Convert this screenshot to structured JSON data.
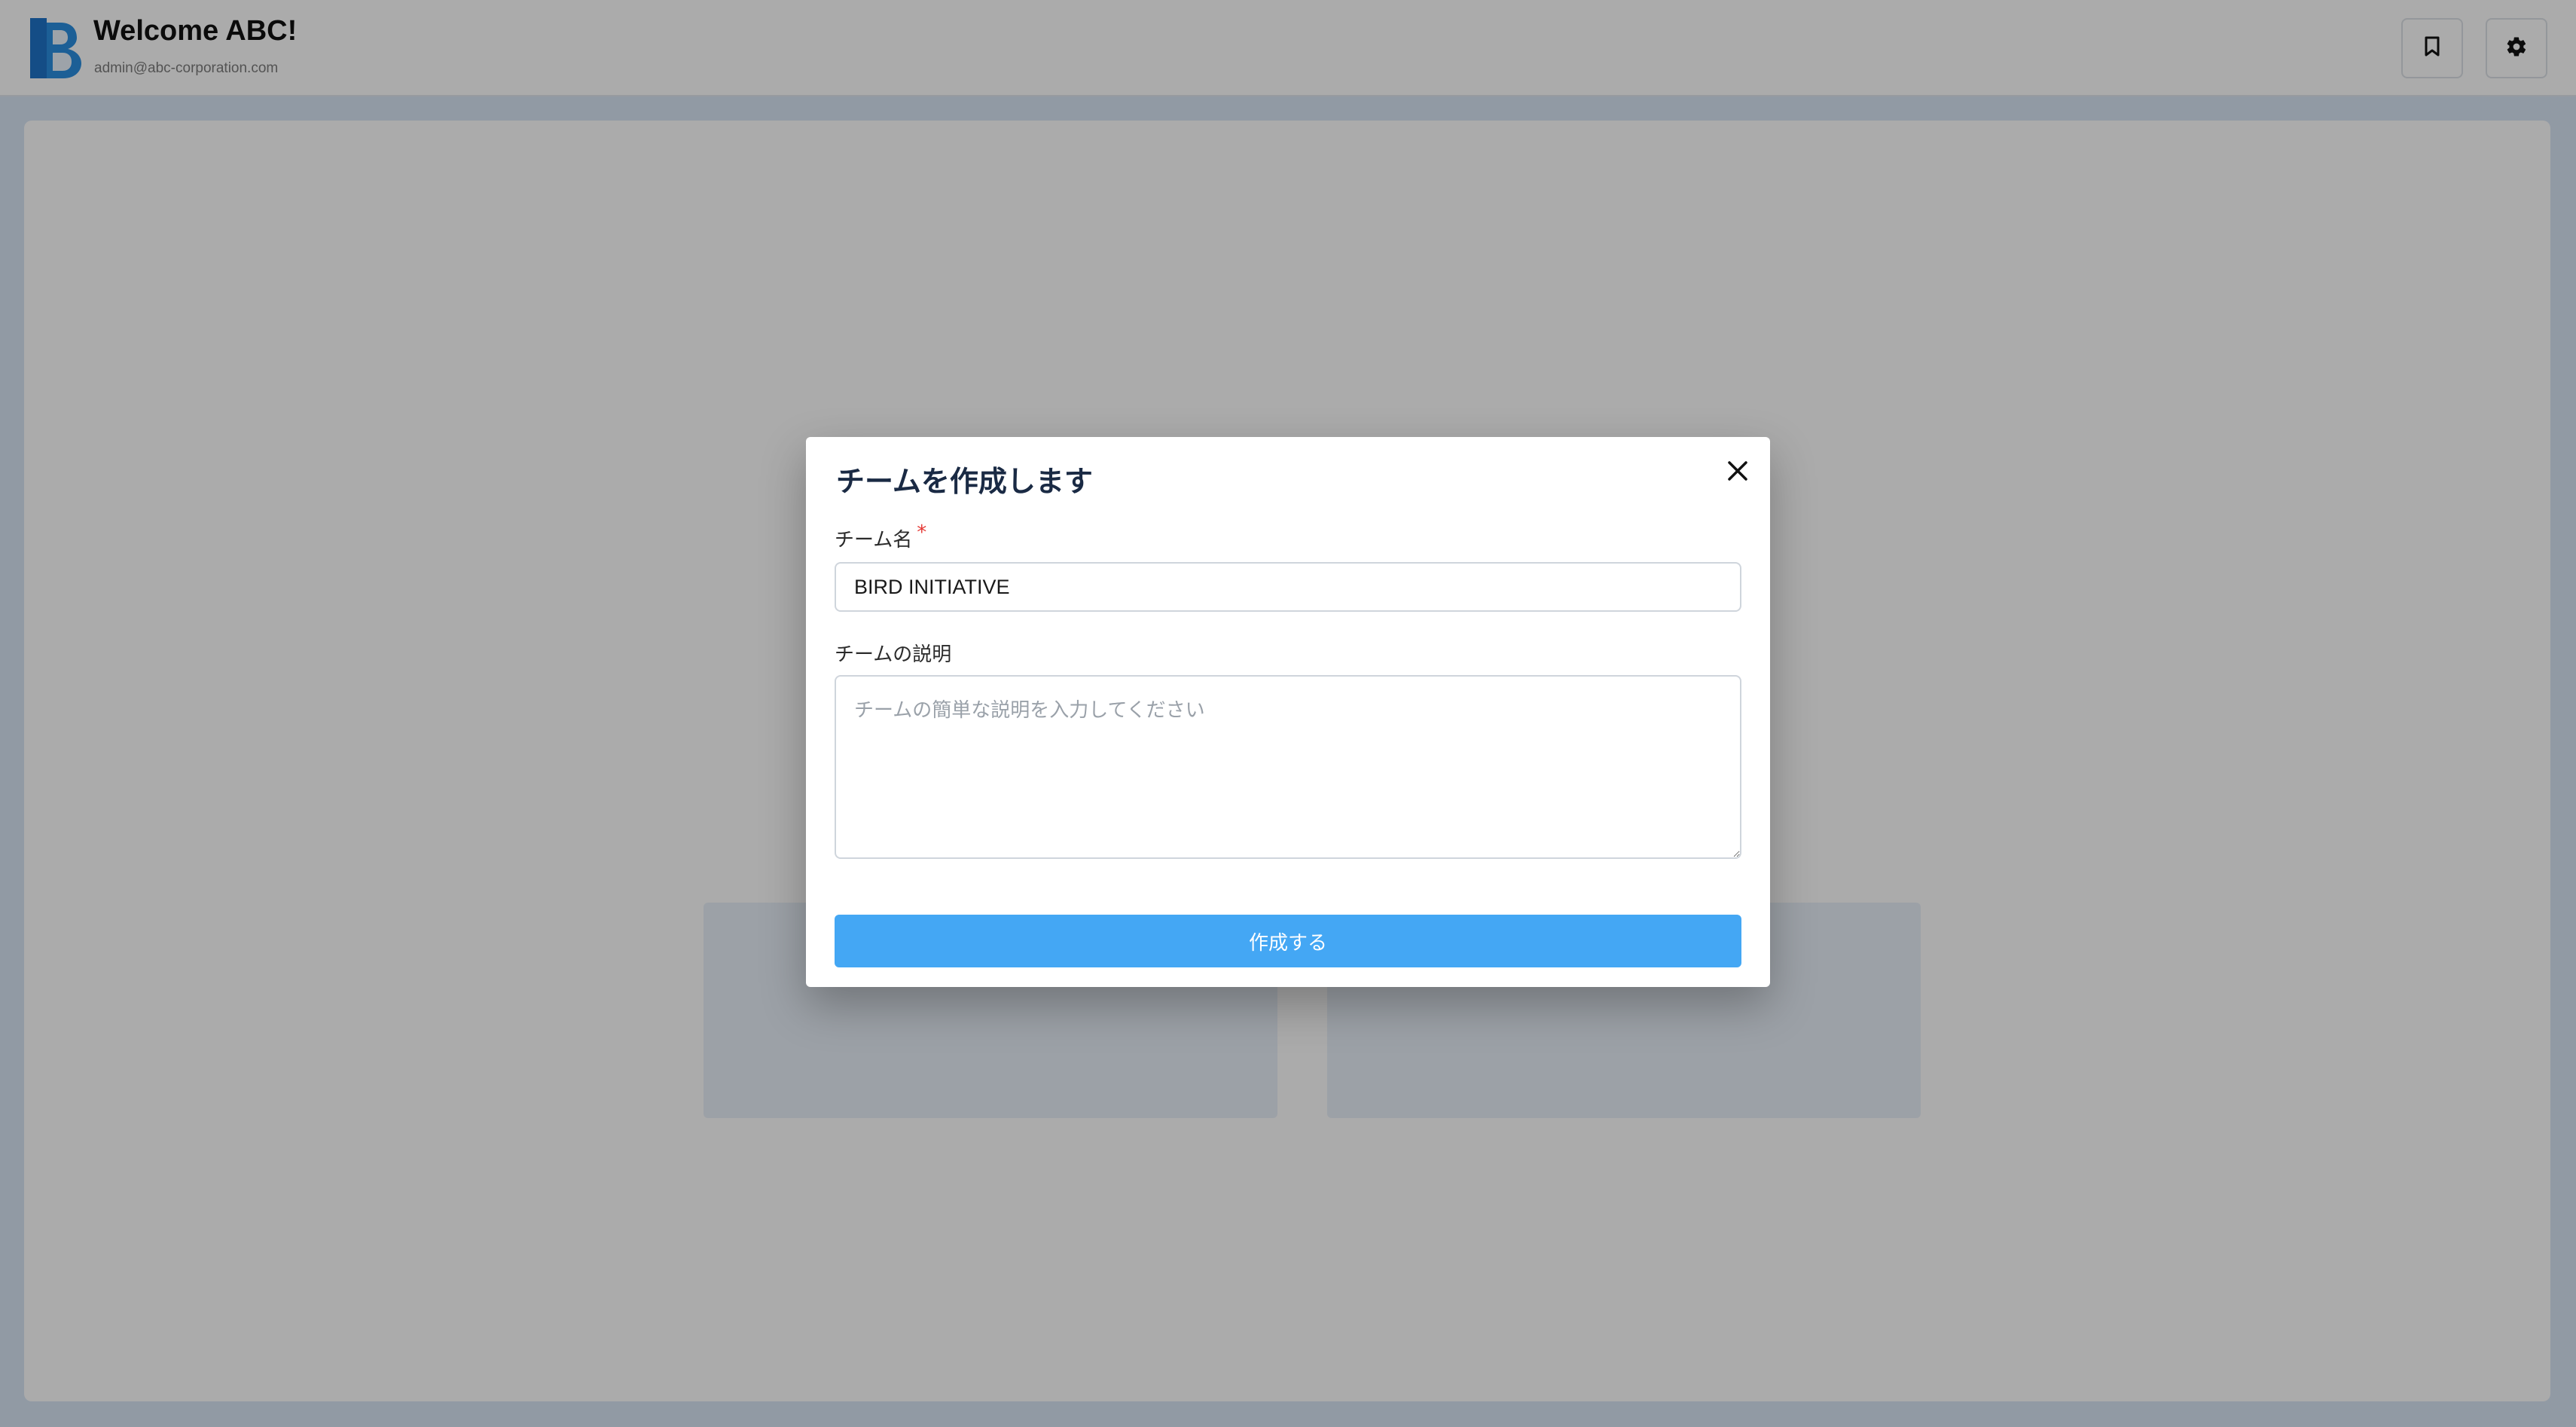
{
  "header": {
    "welcome": "Welcome ABC!",
    "email": "admin@abc-corporation.com",
    "logo_letter": "B"
  },
  "icons": {
    "bookmark": "bookmark-icon",
    "settings": "gear-icon",
    "close": "close-icon"
  },
  "colors": {
    "brand_blue": "#1e74c8",
    "primary_button": "#44a7f4",
    "required": "#e53935",
    "title_text": "#1a2a44"
  },
  "modal": {
    "title": "チームを作成します",
    "name_label": "チーム名",
    "required_mark": "*",
    "name_value": "BIRD INITIATIVE",
    "description_label": "チームの説明",
    "description_placeholder": "チームの簡単な説明を入力してください",
    "submit_label": "作成する"
  }
}
